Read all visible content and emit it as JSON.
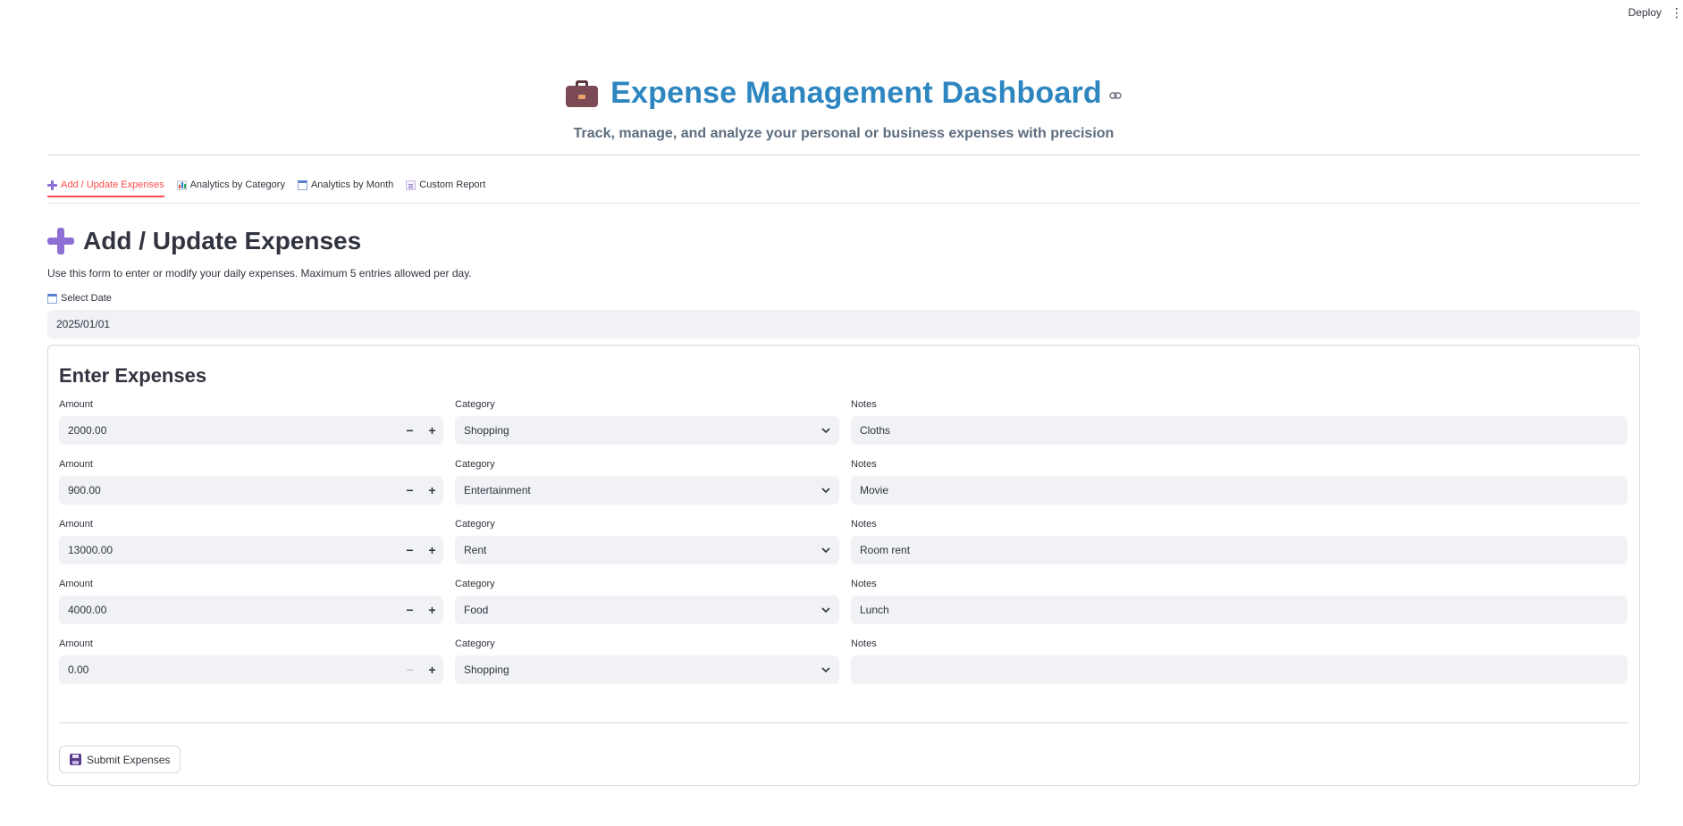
{
  "toolbar": {
    "deploy_label": "Deploy",
    "menu_label": "⋮"
  },
  "header": {
    "title": "Expense Management Dashboard",
    "link_icon": "🔗",
    "subtitle": "Track, manage, and analyze your personal or business expenses with precision"
  },
  "tabs": [
    {
      "label": "Add / Update Expenses",
      "icon": "plus-icon",
      "active": true
    },
    {
      "label": "Analytics by Category",
      "icon": "bar-chart-icon",
      "active": false
    },
    {
      "label": "Analytics by Month",
      "icon": "calendar-icon",
      "active": false
    },
    {
      "label": "Custom Report",
      "icon": "memo-icon",
      "active": false
    }
  ],
  "section": {
    "title": "Add / Update Expenses",
    "description": "Use this form to enter or modify your daily expenses. Maximum 5 entries allowed per day."
  },
  "date": {
    "label": "Select Date",
    "value": "2025/01/01"
  },
  "form": {
    "title": "Enter Expenses",
    "amount_label": "Amount",
    "category_label": "Category",
    "notes_label": "Notes",
    "rows": [
      {
        "amount": "2000.00",
        "category": "Shopping",
        "notes": "Cloths"
      },
      {
        "amount": "900.00",
        "category": "Entertainment",
        "notes": "Movie"
      },
      {
        "amount": "13000.00",
        "category": "Rent",
        "notes": "Room rent"
      },
      {
        "amount": "4000.00",
        "category": "Food",
        "notes": "Lunch"
      },
      {
        "amount": "0.00",
        "category": "Shopping",
        "notes": ""
      }
    ],
    "submit_label": "Submit Expenses"
  },
  "colors": {
    "title": "#2e86c1",
    "active_tab": "#ff4b4b",
    "input_bg": "#f0f2f6",
    "accent": "#8e6fd6"
  }
}
